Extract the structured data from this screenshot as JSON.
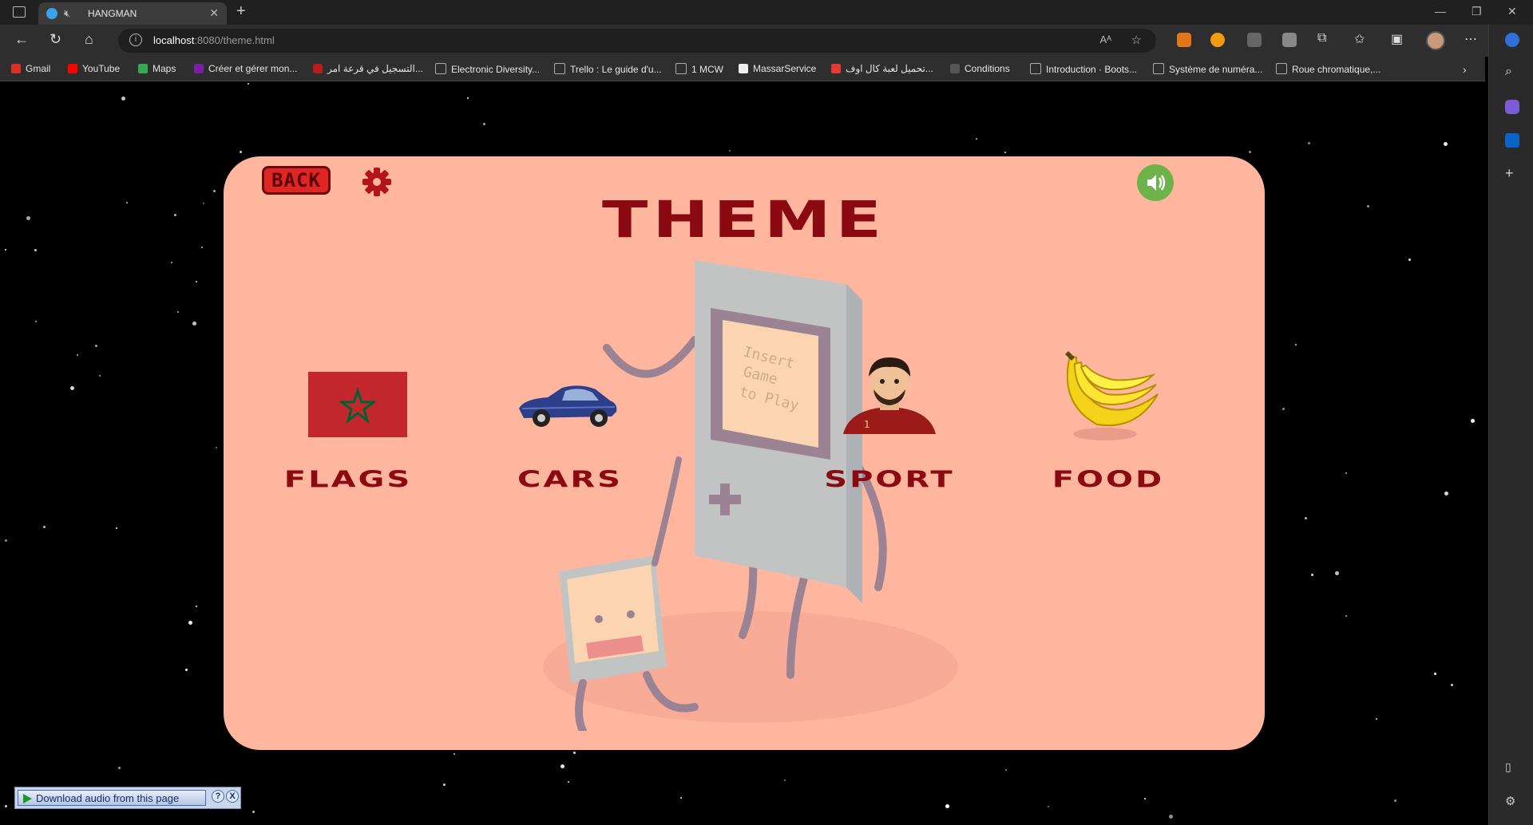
{
  "browser": {
    "tab_title": "HANGMAN",
    "url_host": "localhost",
    "url_rest": ":8080/theme.html",
    "info_glyph": "i",
    "bookmarks": [
      {
        "label": "Gmail",
        "color": "#d93025"
      },
      {
        "label": "YouTube",
        "color": "#ff0000"
      },
      {
        "label": "Maps",
        "color": "#34a853"
      },
      {
        "label": "Créer et gérer mon...",
        "color": "#7b1fa2"
      },
      {
        "label": "التسجيل في قرعة امر...",
        "color": "#b71c1c"
      },
      {
        "label": "Electronic Diversity...",
        "color": "#888888"
      },
      {
        "label": "Trello : Le guide d'u...",
        "color": "#888888"
      },
      {
        "label": "1 MCW",
        "color": "#888888"
      },
      {
        "label": "MassarService",
        "color": "#eeeeee"
      },
      {
        "label": "تحميل لعبة كال اوف...",
        "color": "#e53935"
      },
      {
        "label": "Conditions",
        "color": "#555555"
      },
      {
        "label": "Introduction · Boots...",
        "color": "#888888"
      },
      {
        "label": "Système de numéra...",
        "color": "#888888"
      },
      {
        "label": "Roue chromatique,...",
        "color": "#888888"
      }
    ]
  },
  "page": {
    "back_label": "BACK",
    "title": "THEME",
    "themes": [
      {
        "label": "FLAGS",
        "icon": "morocco-flag-icon"
      },
      {
        "label": "CARS",
        "icon": "car-icon"
      },
      {
        "label": "SPORT",
        "icon": "footballer-icon"
      },
      {
        "label": "FOOD",
        "icon": "banana-icon"
      }
    ],
    "illustration_text": [
      "Insert",
      "Game",
      "to Play"
    ],
    "jersey_number": "1"
  },
  "download_bar": {
    "label": "Download audio from this page",
    "help": "?",
    "close": "X"
  },
  "colors": {
    "card_bg": "#ffb69f",
    "title_red": "#8b0a12",
    "back_red": "#e02525",
    "sound_green": "#6db34a"
  }
}
